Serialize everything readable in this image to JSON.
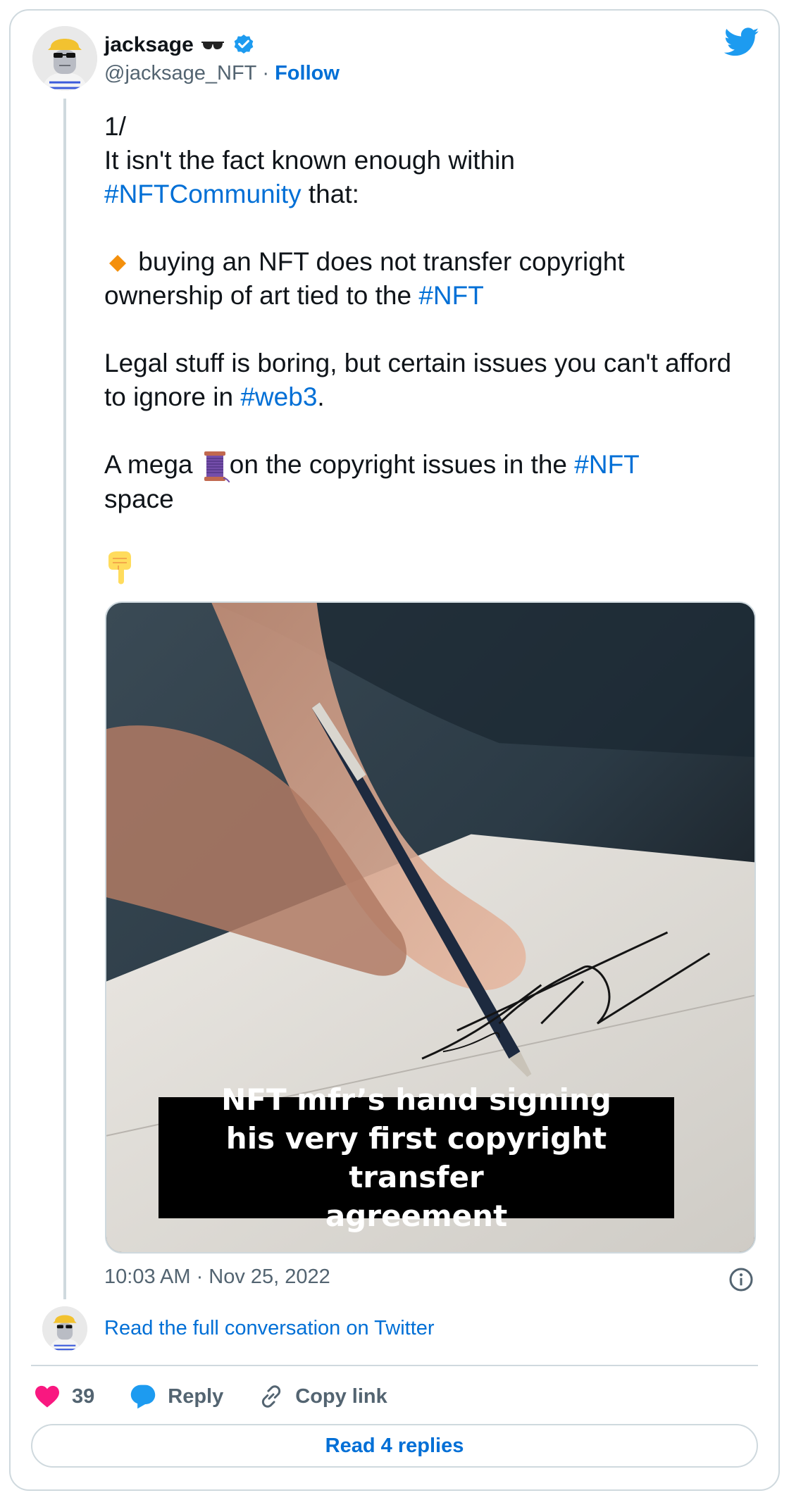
{
  "author": {
    "name": "jacksage",
    "name_emoji": "sunglasses",
    "handle": "@jacksage_NFT",
    "separator": "·",
    "follow_label": "Follow",
    "verified": true
  },
  "tweet": {
    "line_thread_number": "1/",
    "para1_text": "It isn't the fact known enough within",
    "para1_tag": "#NFTCommunity",
    "para1_end": " that:",
    "bullet_icon": "orange-diamond",
    "bullet_text_a": " buying an NFT does not transfer copyright ownership of art tied to the ",
    "bullet_tag": "#NFT",
    "para3_text": "Legal stuff is boring, but certain issues you can't afford to ignore in ",
    "para3_tag": "#web3",
    "para3_end": ".",
    "para4_a": "A mega ",
    "para4_icon": "thread-spool",
    "para4_b": "on the copyright issues in the ",
    "para4_tag": "#NFT",
    "para4_end": " space",
    "pointer_icon": "backhand-index-pointing-down"
  },
  "media": {
    "caption_line1": "NFT mfr’s hand signing",
    "caption_line2": "his very first copyright transfer",
    "caption_line3": "agreement"
  },
  "timestamp": "10:03 AM · Nov 25, 2022",
  "read_conversation": "Read the full conversation on Twitter",
  "actions": {
    "likes_count": "39",
    "reply_label": "Reply",
    "copy_link_label": "Copy link"
  },
  "read_replies_label": "Read 4 replies",
  "colors": {
    "link_blue": "#006fd6",
    "twitter_blue": "#1d9bf0",
    "like_pink": "#f91880",
    "muted_text": "#536471",
    "border": "#cfd9de"
  }
}
